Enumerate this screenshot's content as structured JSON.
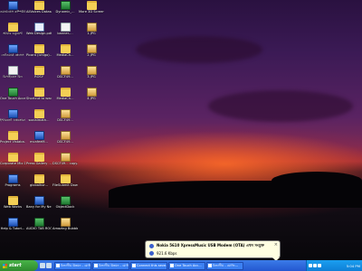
{
  "desktop": {
    "icons": [
      {
        "label": "ওয়ার্ডপ্রেস কম্পিউটার",
        "icon": "my-computer-icon",
        "kind": "exe"
      },
      {
        "label": "AllVoices Datasource",
        "icon": "folder-icon",
        "kind": "folder"
      },
      {
        "label": "Dynamic_...",
        "icon": "app-icon",
        "kind": "app"
      },
      {
        "label": "More 3D Screens...",
        "icon": "folder-icon",
        "kind": "folder"
      },
      {
        "label": "আমার ডকুমেন্ট",
        "icon": "my-documents-icon",
        "kind": "folder"
      },
      {
        "label": "Web Design.pdf",
        "icon": "pdf-icon",
        "kind": "doc"
      },
      {
        "label": "banner-...",
        "icon": "file-icon",
        "kind": "file"
      },
      {
        "label": "1.JPG",
        "icon": "image-icon",
        "kind": "img"
      },
      {
        "label": "নেটওয়ার্ক প্লেসেস",
        "icon": "network-icon",
        "kind": "exe"
      },
      {
        "label": "Picard (Ichigo)...",
        "icon": "folder-icon",
        "kind": "folder"
      },
      {
        "label": "MediaCh...",
        "icon": "folder-icon",
        "kind": "folder"
      },
      {
        "label": "2.JPG",
        "icon": "image-icon",
        "kind": "img"
      },
      {
        "label": "রিসাইকেল বিন",
        "icon": "recycle-bin-icon",
        "kind": "file"
      },
      {
        "label": "ROSY",
        "icon": "folder-icon",
        "kind": "folder"
      },
      {
        "label": "DSCF49...",
        "icon": "image-icon",
        "kind": "img"
      },
      {
        "label": "3.JPG",
        "icon": "image-icon",
        "kind": "img"
      },
      {
        "label": "One Touch Access",
        "icon": "app-icon",
        "kind": "app"
      },
      {
        "label": "Shortcut to www",
        "icon": "folder-icon",
        "kind": "folder"
      },
      {
        "label": "MediaCh...",
        "icon": "folder-icon",
        "kind": "folder"
      },
      {
        "label": "4.JPG",
        "icon": "image-icon",
        "kind": "img"
      },
      {
        "label": "ইন্টারনেট এক্সপ্লোরার",
        "icon": "internet-explorer-icon",
        "kind": "exe"
      },
      {
        "label": "socialmath...",
        "icon": "folder-icon",
        "kind": "folder"
      },
      {
        "label": "DSCF49...",
        "icon": "image-icon",
        "kind": "img"
      },
      {
        "label": "",
        "icon": "",
        "kind": "none"
      },
      {
        "label": "Project Vistaba...",
        "icon": "folder-icon",
        "kind": "folder"
      },
      {
        "label": "mcafeeM...",
        "icon": "app-icon",
        "kind": "exe"
      },
      {
        "label": "DSCF49...",
        "icon": "image-icon",
        "kind": "img"
      },
      {
        "label": "",
        "icon": "",
        "kind": "none"
      },
      {
        "label": "Corporate Mix Demo",
        "icon": "folder-icon",
        "kind": "folder"
      },
      {
        "label": "Press Gallery ...",
        "icon": "folder-icon",
        "kind": "folder"
      },
      {
        "label": "DSCF49... copy.jpg",
        "icon": "image-icon",
        "kind": "img"
      },
      {
        "label": "",
        "icon": "",
        "kind": "none"
      },
      {
        "label": "Programs",
        "icon": "programs-icon",
        "kind": "exe"
      },
      {
        "label": "globalhor...",
        "icon": "folder-icon",
        "kind": "folder"
      },
      {
        "label": "FileSubmit Downloads",
        "icon": "folder-icon",
        "kind": "folder"
      },
      {
        "label": "",
        "icon": "",
        "kind": "none"
      },
      {
        "label": "Web Works",
        "icon": "folder-icon",
        "kind": "folder"
      },
      {
        "label": "Bany for My Ne...",
        "icon": "app-icon",
        "kind": "exe"
      },
      {
        "label": "ObjectDock",
        "icon": "app-icon",
        "kind": "app"
      },
      {
        "label": "",
        "icon": "",
        "kind": "none"
      },
      {
        "label": "Help & Tutori...",
        "icon": "help-icon",
        "kind": "exe"
      },
      {
        "label": "AUDIO TAB ROOM",
        "icon": "audio-icon",
        "kind": "app"
      },
      {
        "label": "Amazing Bubbles ...",
        "icon": "game-icon",
        "kind": "img"
      },
      {
        "label": "",
        "icon": "",
        "kind": "none"
      }
    ]
  },
  "balloon": {
    "title": "Nokia 5610 XpressMusic USB Modem (OTA) এখন সংযুক্ত",
    "subtitle": "921.6 Kbps",
    "close": "×"
  },
  "taskbar": {
    "start_label": "start",
    "tasks": [
      {
        "label": "বিভাগীয় উন্নয়ন - মোজি..."
      },
      {
        "label": "বিভাগীয় উন্নয়ন - মোজি..."
      },
      {
        "label": "Connect this seve..."
      },
      {
        "label": "One Touch Acc..."
      },
      {
        "label": "বিভাগীয় - মোজি..."
      }
    ],
    "clock": "5:04 PM"
  }
}
